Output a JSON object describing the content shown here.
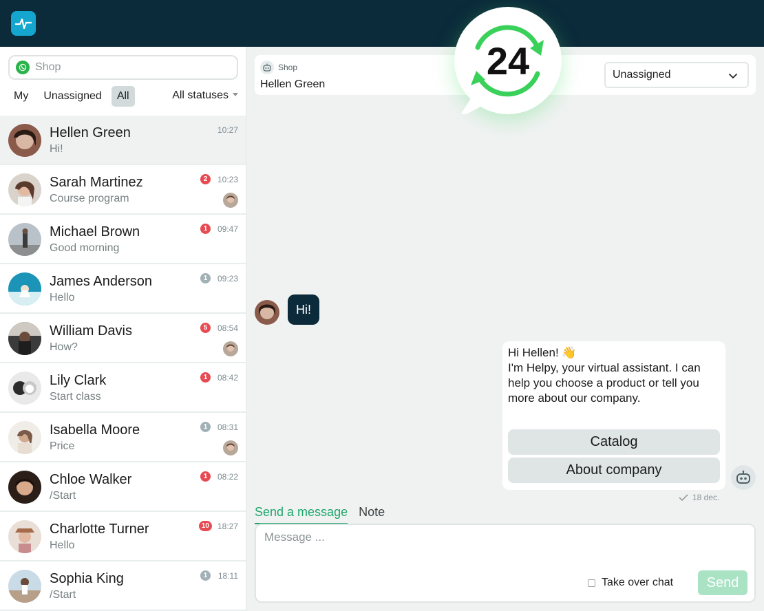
{
  "search": {
    "placeholder": "Shop"
  },
  "filters": {
    "tabs": [
      "My",
      "Unassigned",
      "All"
    ],
    "active": "All",
    "status_filter": "All statuses"
  },
  "chats": [
    {
      "name": "Hellen Green",
      "preview": "Hi!",
      "time": "10:27",
      "badge": "",
      "badge_color": "",
      "selected": true,
      "agent_avatar": false
    },
    {
      "name": "Sarah Martinez",
      "preview": "Course program",
      "time": "10:23",
      "badge": "2",
      "badge_color": "red",
      "selected": false,
      "agent_avatar": true
    },
    {
      "name": "Michael Brown",
      "preview": "Good morning",
      "time": "09:47",
      "badge": "1",
      "badge_color": "red",
      "selected": false,
      "agent_avatar": false
    },
    {
      "name": "James Anderson",
      "preview": "Hello",
      "time": "09:23",
      "badge": "1",
      "badge_color": "grey",
      "selected": false,
      "agent_avatar": false
    },
    {
      "name": "William Davis",
      "preview": "How?",
      "time": "08:54",
      "badge": "5",
      "badge_color": "red",
      "selected": false,
      "agent_avatar": true
    },
    {
      "name": "Lily Clark",
      "preview": "Start class",
      "time": "08:42",
      "badge": "1",
      "badge_color": "red",
      "selected": false,
      "agent_avatar": false
    },
    {
      "name": "Isabella Moore",
      "preview": "Price",
      "time": "08:31",
      "badge": "1",
      "badge_color": "grey",
      "selected": false,
      "agent_avatar": true
    },
    {
      "name": "Chloe Walker",
      "preview": "/Start",
      "time": "08:22",
      "badge": "1",
      "badge_color": "red",
      "selected": false,
      "agent_avatar": false
    },
    {
      "name": "Charlotte Turner",
      "preview": "Hello",
      "time": "18:27",
      "badge": "10",
      "badge_color": "red",
      "selected": false,
      "agent_avatar": false
    },
    {
      "name": "Sophia King",
      "preview": "/Start",
      "time": "18:11",
      "badge": "1",
      "badge_color": "grey",
      "selected": false,
      "agent_avatar": false
    }
  ],
  "header": {
    "source": "Shop",
    "contact_name": "Hellen Green",
    "assignee": "Unassigned"
  },
  "logo": {
    "number": "24"
  },
  "messages": {
    "incoming": "Hi!",
    "outgoing_lines": [
      "Hi Hellen! 👋",
      "I'm Helpy, your virtual assistant. I can help you choose a product or tell you more about our company."
    ],
    "quick_replies": [
      "Catalog",
      "About company"
    ],
    "date": "18 dec."
  },
  "composer": {
    "tabs": [
      "Send a message",
      "Note"
    ],
    "active_tab": "Send a message",
    "placeholder": "Message ...",
    "takeover_label": "Take over chat",
    "send_label": "Send"
  },
  "colors": {
    "topbar": "#0b2a3a",
    "accent": "#1fa66b",
    "badge_red": "#e84a52",
    "badge_grey": "#a2b1b8",
    "logo_green": "#3ad15a"
  }
}
